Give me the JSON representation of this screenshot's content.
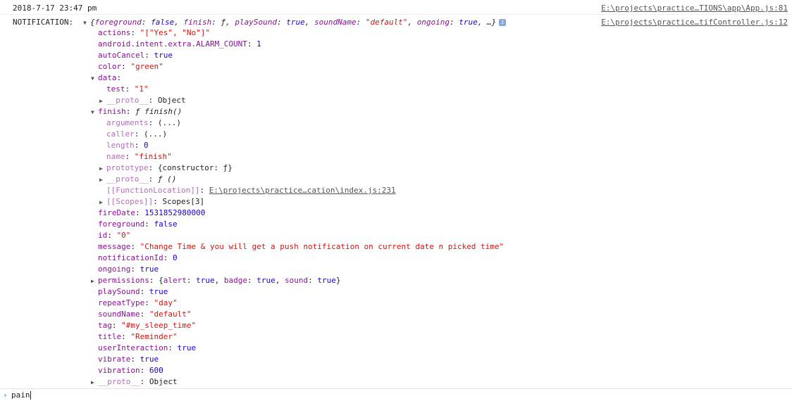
{
  "timestamp_msg": {
    "text": "2018-7-17 23:47 pm",
    "source": "E:\\projects\\practice…TIONS\\app\\App.js:81"
  },
  "notification_msg": {
    "label": "NOTIFICATION:",
    "source": "E:\\projects\\practice…tifController.js:12",
    "preview": {
      "open": "{",
      "p1k": "foreground",
      "p1v": "false",
      "p2k": "finish",
      "p2v": "ƒ",
      "p3k": "playSound",
      "p3v": "true",
      "p4k": "soundName",
      "p4v": "\"default\"",
      "p5k": "ongoing",
      "p5v": "true",
      "tail": "…}"
    },
    "info_icon": "i"
  },
  "props": {
    "actions_k": "actions",
    "actions_v": "\"[\"Yes\", \"No\"]\"",
    "alarm_k": "android.intent.extra.ALARM_COUNT",
    "alarm_v": "1",
    "autoCancel_k": "autoCancel",
    "autoCancel_v": "true",
    "color_k": "color",
    "color_v": "\"green\"",
    "data_k": "data",
    "test_k": "test",
    "test_v": "\"1\"",
    "proto_k": "__proto__",
    "proto_v": "Object",
    "finish_k": "finish",
    "finish_v": "ƒ finish()",
    "arguments_k": "arguments",
    "arguments_v": "(...)",
    "caller_k": "caller",
    "caller_v": "(...)",
    "length_k": "length",
    "length_v": "0",
    "name_k": "name",
    "name_v": "\"finish\"",
    "prototype_k": "prototype",
    "prototype_v": "{constructor: ƒ}",
    "fproto_k": "__proto__",
    "fproto_v": "ƒ ()",
    "funcloc_k": "[[FunctionLocation]]",
    "funcloc_v": "E:\\projects\\practice…cation\\index.js:231",
    "scopes_k": "[[Scopes]]",
    "scopes_v": "Scopes[3]",
    "fireDate_k": "fireDate",
    "fireDate_v": "1531852980000",
    "foreground_k": "foreground",
    "foreground_v": "false",
    "id_k": "id",
    "id_v": "\"0\"",
    "message_k": "message",
    "message_v": "\"Change Time & you will get a push notification on current date n picked time\"",
    "notificationId_k": "notificationId",
    "notificationId_v": "0",
    "ongoing_k": "ongoing",
    "ongoing_v": "true",
    "permissions_k": "permissions",
    "perm_alert_k": "alert",
    "perm_alert_v": "true",
    "perm_badge_k": "badge",
    "perm_badge_v": "true",
    "perm_sound_k": "sound",
    "perm_sound_v": "true",
    "playSound_k": "playSound",
    "playSound_v": "true",
    "repeatType_k": "repeatType",
    "repeatType_v": "\"day\"",
    "soundName_k": "soundName",
    "soundName_v": "\"default\"",
    "tag_k": "tag",
    "tag_v": "\"#my_sleep_time\"",
    "title_k": "title",
    "title_v": "\"Reminder\"",
    "userInteraction_k": "userInteraction",
    "userInteraction_v": "true",
    "vibrate_k": "vibrate",
    "vibrate_v": "true",
    "vibration_k": "vibration",
    "vibration_v": "600",
    "rootproto_k": "__proto__",
    "rootproto_v": "Object"
  },
  "console_input": {
    "prompt": "›",
    "value": "pain"
  },
  "icons": {
    "expanded": "▼",
    "collapsed": "▶"
  }
}
